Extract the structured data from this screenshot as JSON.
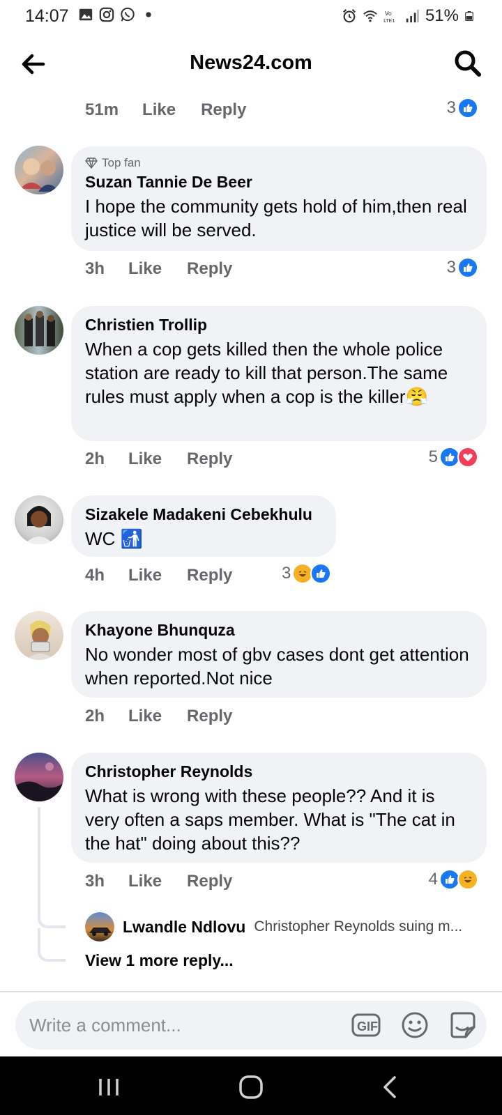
{
  "status_bar": {
    "time": "14:07",
    "battery": "51%",
    "left_icons": [
      "gallery-icon",
      "instagram-icon",
      "whatsapp-icon",
      "dot-icon"
    ],
    "right_icons": [
      "alarm-icon",
      "wifi-icon",
      "volte-icon",
      "signal-icon",
      "battery-icon"
    ]
  },
  "header": {
    "title": "News24.com"
  },
  "top_meta": {
    "time": "51m",
    "like": "Like",
    "reply": "Reply",
    "reaction_count": "3"
  },
  "comments": [
    {
      "badge": "Top fan",
      "author": "Suzan Tannie De Beer",
      "text": "I hope the community gets hold of him,then real justice will be served.",
      "time": "3h",
      "like": "Like",
      "reply": "Reply",
      "reaction_count": "3"
    },
    {
      "author": "Christien Trollip",
      "text": "When a cop gets killed then the whole police station are ready to kill that person.The same rules must apply when a cop is the killer😤",
      "time": "2h",
      "like": "Like",
      "reply": "Reply",
      "reaction_count": "5"
    },
    {
      "author": "Sizakele Madakeni Cebekhulu",
      "text": "WC 🚮",
      "time": "4h",
      "like": "Like",
      "reply": "Reply",
      "reaction_count": "3"
    },
    {
      "author": "Khayone Bhunquza",
      "text": "No wonder most of gbv cases dont get attention when reported.Not nice",
      "time": "2h",
      "like": "Like",
      "reply": "Reply"
    },
    {
      "author": "Christopher Reynolds",
      "text": "What is wrong with these people?? And it is very often a saps member. What is \"The cat in the hat\" doing about this??",
      "time": "3h",
      "like": "Like",
      "reply": "Reply",
      "reaction_count": "4"
    }
  ],
  "reply_preview": {
    "author": "Lwandle Ndlovu",
    "snippet": "Christopher Reynolds  suing m..."
  },
  "view_more": "View 1 more reply...",
  "composer": {
    "placeholder": "Write a comment...",
    "gif_label": "GIF"
  },
  "colors": {
    "like_blue": "#1877f2",
    "love_red": "#f33e58",
    "haha_yellow": "#f7b125",
    "bubble_bg": "#f0f2f5",
    "meta_gray": "#65676b"
  }
}
